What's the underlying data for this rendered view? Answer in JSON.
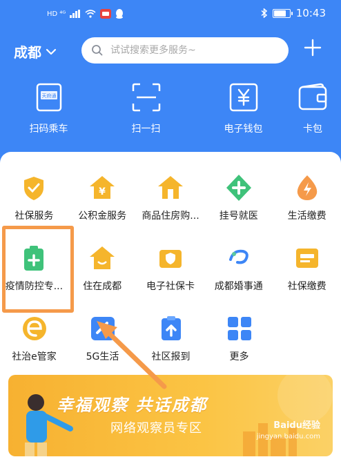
{
  "status_bar": {
    "signal_text": "HD ⁴ᴳ",
    "time": "10:43",
    "battery_level": 0.8
  },
  "header": {
    "city": "成都",
    "search_placeholder": "试试搜索更多服务~"
  },
  "quick_actions": [
    {
      "label": "扫码乘车",
      "icon": "transit-card-icon"
    },
    {
      "label": "扫一扫",
      "icon": "scan-icon"
    },
    {
      "label": "电子钱包",
      "icon": "yuan-wallet-icon"
    },
    {
      "label": "卡包",
      "icon": "card-wallet-icon"
    }
  ],
  "services": [
    {
      "label": "社保服务",
      "icon": "shield-check-icon",
      "color": "#f5b52c"
    },
    {
      "label": "公积金服务",
      "icon": "house-yuan-icon",
      "color": "#f5b52c"
    },
    {
      "label": "商品住房购...",
      "icon": "house-tag-icon",
      "color": "#f5b52c"
    },
    {
      "label": "挂号就医",
      "icon": "medical-cross-icon",
      "color": "#3fc27a"
    },
    {
      "label": "生活缴费",
      "icon": "lightning-icon",
      "color": "#f59a4a"
    },
    {
      "label": "疫情防控专...",
      "icon": "medical-kit-icon",
      "color": "#3fc27a"
    },
    {
      "label": "住在成都",
      "icon": "house-smile-icon",
      "color": "#f5b52c"
    },
    {
      "label": "电子社保卡",
      "icon": "shield-card-icon",
      "color": "#f5b52c"
    },
    {
      "label": "成都婚事通",
      "icon": "swirl-logo-icon",
      "color": "#3d86f6"
    },
    {
      "label": "社保缴费",
      "icon": "id-card-icon",
      "color": "#f5b52c"
    },
    {
      "label": "社治e管家",
      "icon": "e-logo-icon",
      "color": "#f5b52c"
    },
    {
      "label": "5G生活",
      "icon": "5g-icon",
      "color": "#3d86f6"
    },
    {
      "label": "社区报到",
      "icon": "clipboard-up-icon",
      "color": "#3d86f6"
    },
    {
      "label": "更多",
      "icon": "grid-more-icon",
      "color": "#3d86f6"
    }
  ],
  "banner": {
    "title": "幸福观察 共话成都",
    "subtitle": "网络观察员专区"
  },
  "watermark": {
    "line1": "Baidu经验",
    "line2": "jingyan.baidu.com"
  },
  "colors": {
    "primary": "#3d86f6",
    "highlight": "#f59a4a"
  }
}
